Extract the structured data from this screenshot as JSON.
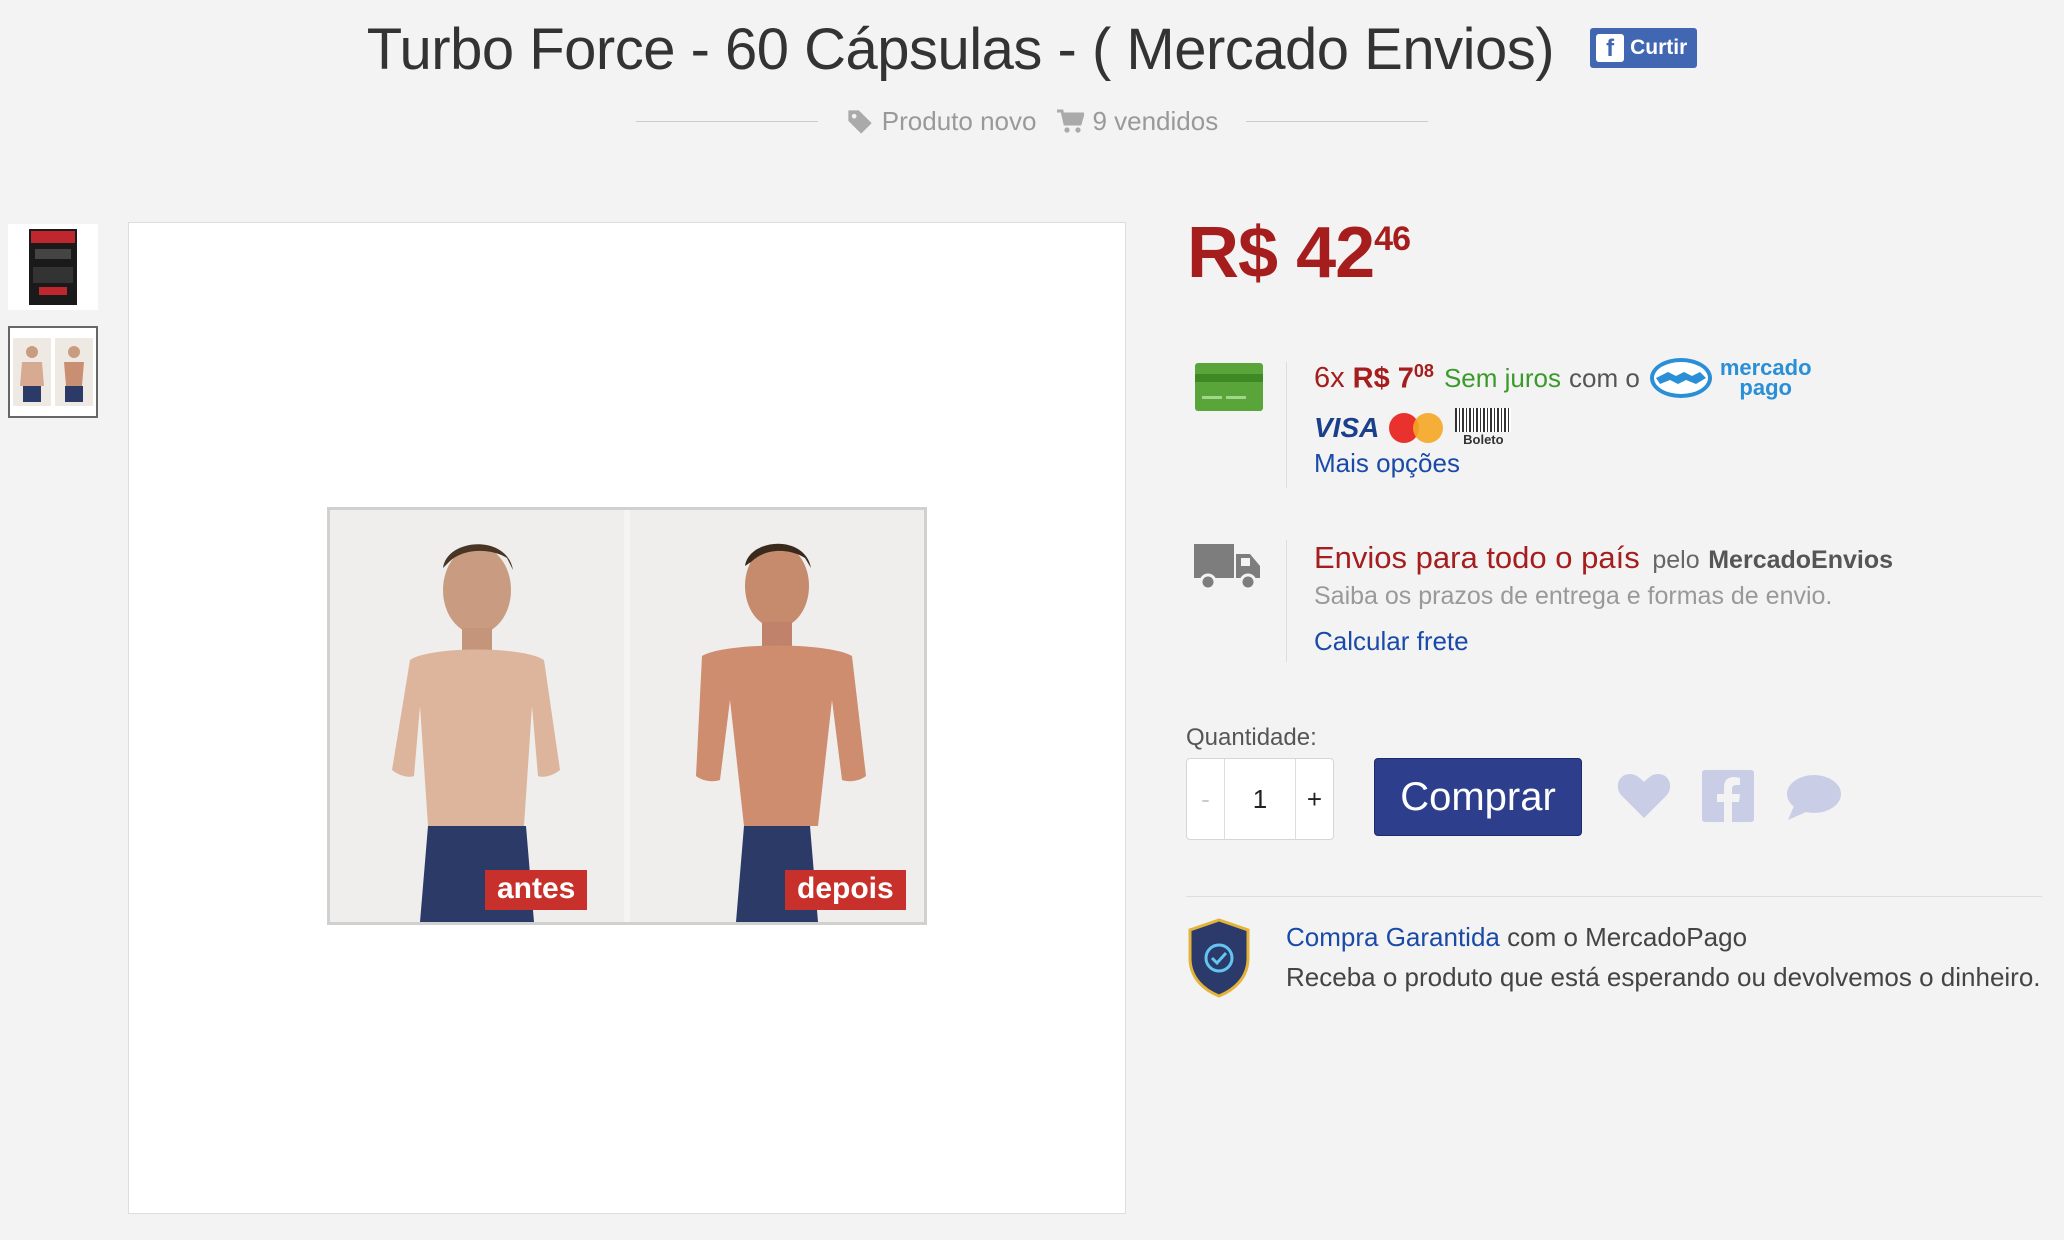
{
  "header": {
    "title": "Turbo Force - 60 Cápsulas - ( Mercado Envios)",
    "like_label": "Curtir",
    "condition": "Produto novo",
    "sold": "9 vendidos"
  },
  "gallery": {
    "thumbnails": [
      "tubo-product-thumb",
      "antes-depois-thumb"
    ],
    "caption_before": "antes",
    "caption_after": "depois"
  },
  "price": {
    "currency": "R$",
    "integer": "42",
    "cents": "46"
  },
  "installments": {
    "count": "6x",
    "value_currency": "R$",
    "value_integer": "7",
    "value_cents": "08",
    "no_interest": "Sem juros",
    "with": "com o",
    "mercadopago_line1": "mercado",
    "mercadopago_line2": "pago",
    "card_visa": "VISA",
    "card_mastercard": "MasterCard",
    "boleto": "Boleto",
    "more_options": "Mais opções"
  },
  "shipping": {
    "title": "Envios para todo o país",
    "pelo": "pelo",
    "service": "MercadoEnvios",
    "subtitle": "Saiba os prazos de entrega e formas de envio.",
    "calc_link": "Calcular frete"
  },
  "purchase": {
    "quantity_label": "Quantidade:",
    "minus": "-",
    "plus": "+",
    "quantity": "1",
    "buy_label": "Comprar"
  },
  "guarantee": {
    "link": "Compra Garantida",
    "with": "com o MercadoPago",
    "text": "Receba o produto que está esperando ou devolvemos o dinheiro."
  },
  "colors": {
    "price_red": "#a61d1d",
    "link_blue": "#1a4aa8",
    "buy_button": "#2d3f8c",
    "green": "#3a9a2a"
  }
}
